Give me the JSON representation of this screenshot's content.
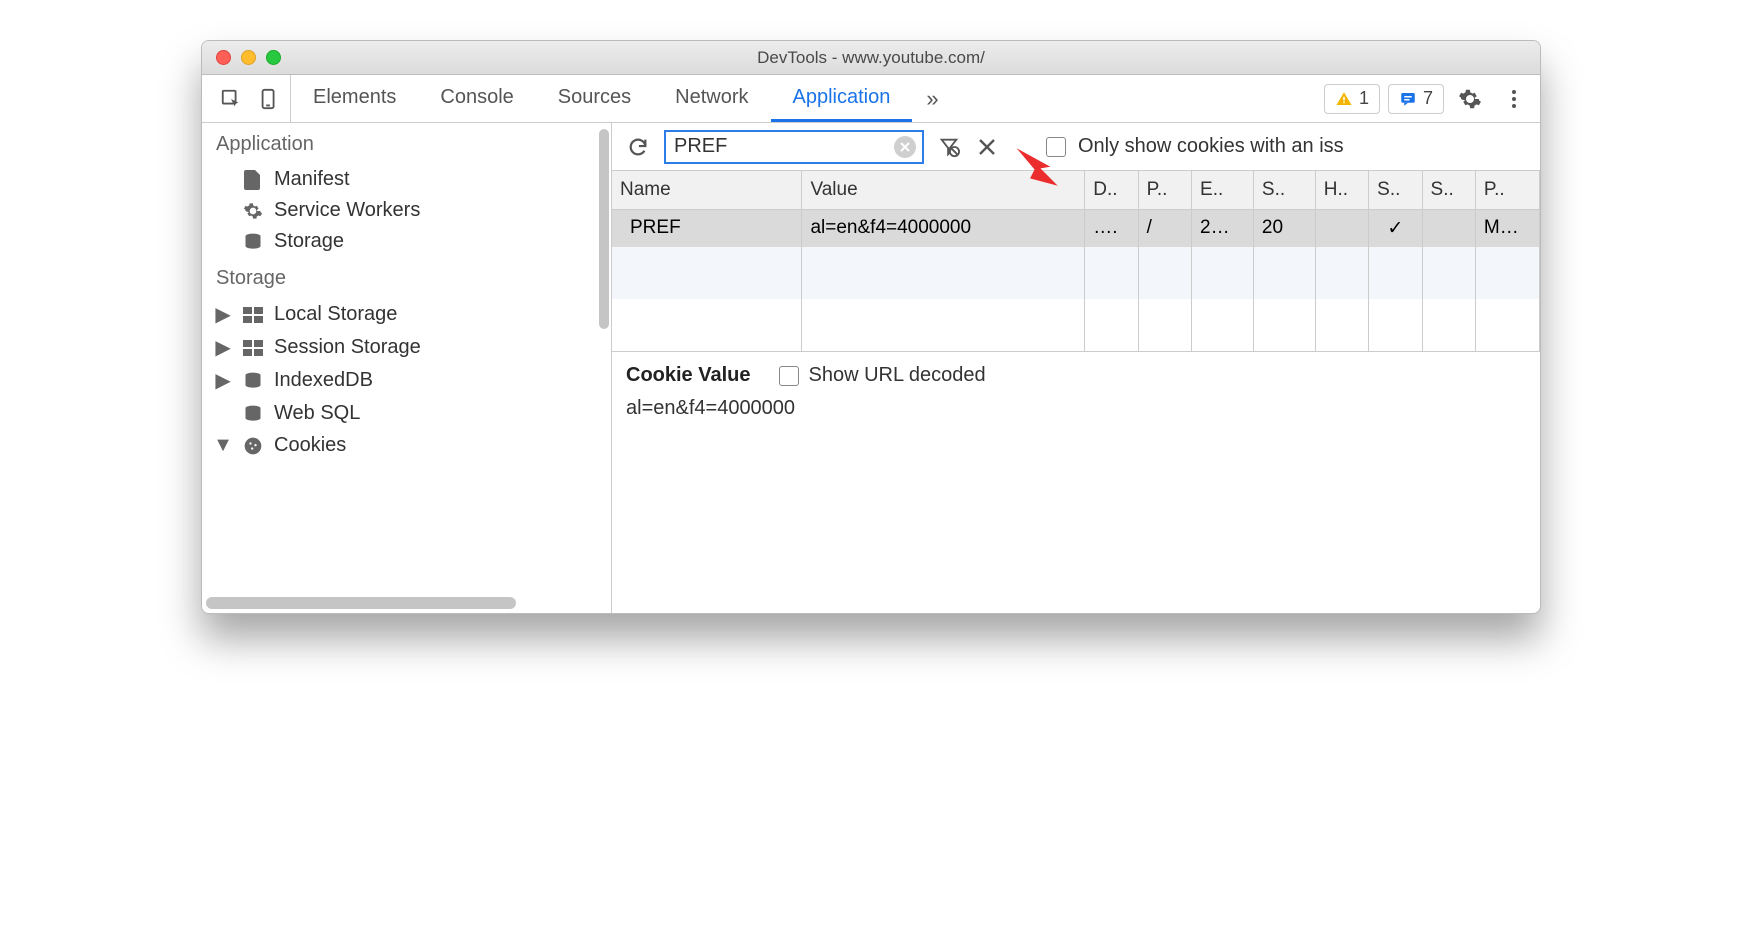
{
  "window": {
    "title": "DevTools - www.youtube.com/"
  },
  "tabs": {
    "items": [
      "Elements",
      "Console",
      "Sources",
      "Network",
      "Application"
    ],
    "active": 4,
    "more": "»"
  },
  "badges": {
    "warnings": "1",
    "messages": "7"
  },
  "sidebar": {
    "sections": [
      {
        "header": "Application",
        "items": [
          {
            "icon": "file-icon",
            "label": "Manifest",
            "expandable": false
          },
          {
            "icon": "gear-icon",
            "label": "Service Workers",
            "expandable": false
          },
          {
            "icon": "database-icon",
            "label": "Storage",
            "expandable": false
          }
        ]
      },
      {
        "header": "Storage",
        "items": [
          {
            "icon": "grid-icon",
            "label": "Local Storage",
            "expandable": true,
            "expanded": false
          },
          {
            "icon": "grid-icon",
            "label": "Session Storage",
            "expandable": true,
            "expanded": false
          },
          {
            "icon": "database-icon",
            "label": "IndexedDB",
            "expandable": true,
            "expanded": false
          },
          {
            "icon": "database-icon",
            "label": "Web SQL",
            "expandable": false
          },
          {
            "icon": "cookie-icon",
            "label": "Cookies",
            "expandable": true,
            "expanded": true
          }
        ]
      }
    ]
  },
  "toolbar": {
    "filter_value": "PREF",
    "only_issues_label": "Only show cookies with an iss"
  },
  "table": {
    "columns": [
      "Name",
      "Value",
      "D..",
      "P..",
      "E..",
      "S..",
      "H..",
      "S..",
      "S..",
      "P.."
    ],
    "rows": [
      {
        "cells": [
          "PREF",
          "al=en&f4=4000000",
          "….",
          "/",
          "2…",
          "20",
          "",
          "✓",
          "",
          "M…"
        ],
        "selected": true
      }
    ]
  },
  "detail": {
    "title": "Cookie Value",
    "show_decoded_label": "Show URL decoded",
    "value": "al=en&f4=4000000"
  }
}
